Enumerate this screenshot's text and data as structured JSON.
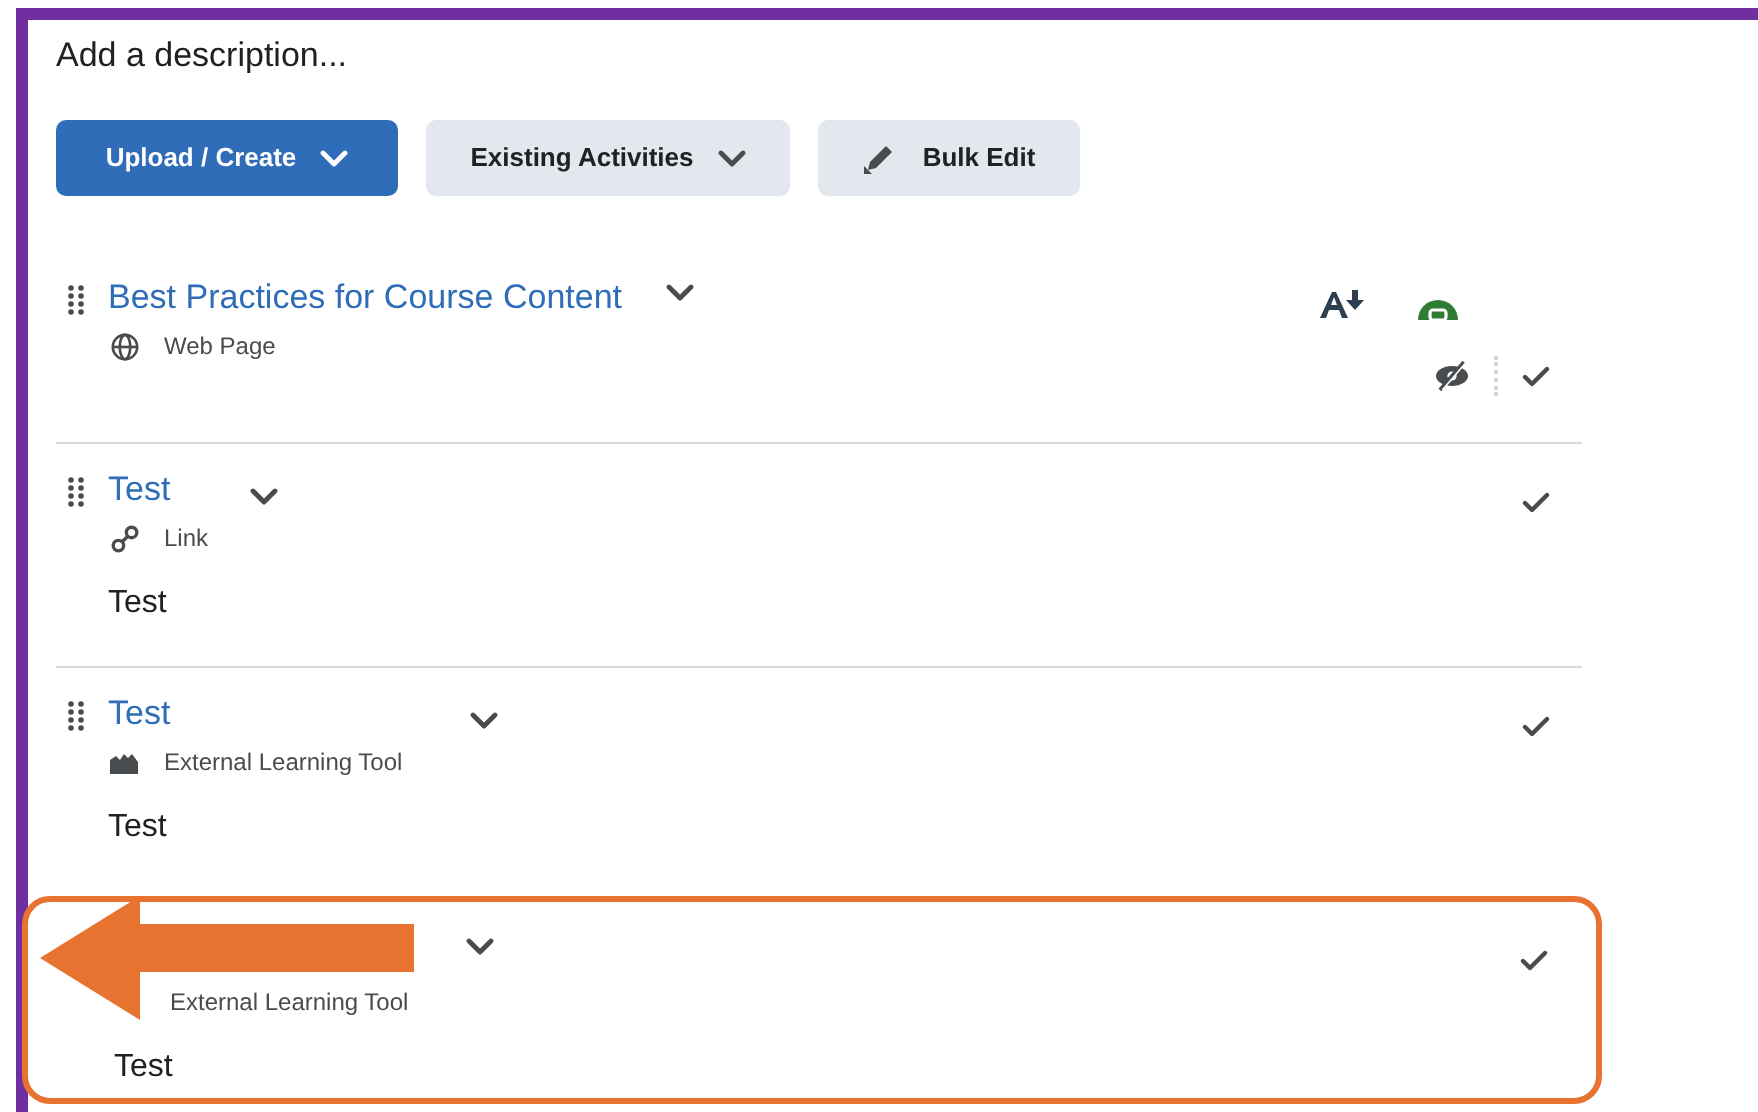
{
  "description_placeholder": "Add a description...",
  "toolbar": [
    {
      "label": "Upload / Create",
      "kind": "primary"
    },
    {
      "label": "Existing Activities",
      "kind": "secondary"
    },
    {
      "label": "Bulk Edit",
      "kind": "edit"
    }
  ],
  "items": [
    {
      "title": "Best Practices for Course Content",
      "type": "Web Page",
      "kind": "web_page",
      "extras": true,
      "highlighted": false
    },
    {
      "title": "Test",
      "type": "Link",
      "kind": "link",
      "extras": false,
      "description": "Test",
      "highlighted": false
    },
    {
      "title": "Test",
      "type": "External Learning Tool",
      "kind": "external_tool",
      "extras": false,
      "description": "Test",
      "highlighted": false
    },
    {
      "type": "External Learning Tool",
      "extras": false,
      "description": "Test",
      "highlighted": true
    }
  ]
}
